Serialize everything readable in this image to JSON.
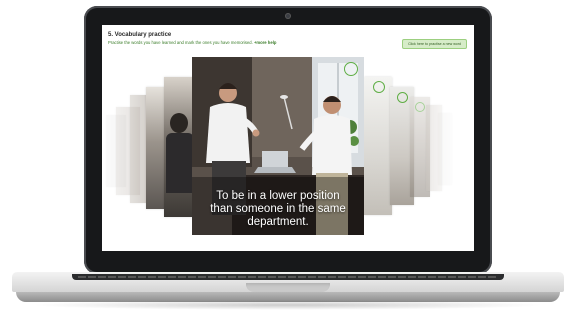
{
  "exercise": {
    "title": "5. Vocabulary practice",
    "instructions": "Practise the words you have learned and mark the ones you have memorised.",
    "more_help": "+more help",
    "practice_button": "Click here to practise a new word"
  },
  "flashcard": {
    "caption_lines": [
      "To be in a lower position",
      "than someone in the same",
      "department."
    ]
  },
  "colors": {
    "accent": "#3b7d2a",
    "ring": "#5fae45",
    "button_bg": "#d6ecc8"
  }
}
